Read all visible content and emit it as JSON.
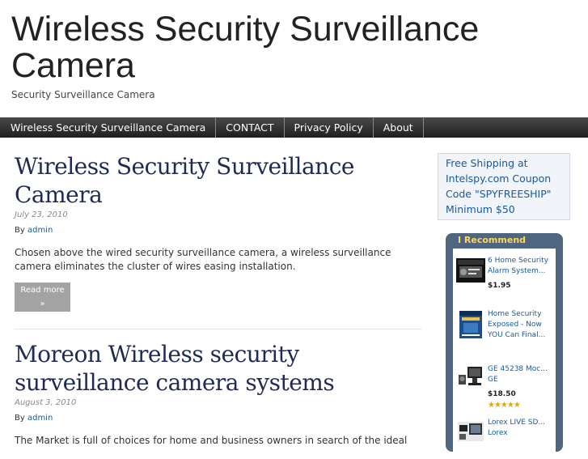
{
  "site": {
    "title": "Wireless Security Surveillance Camera",
    "description": "Security Surveillance Camera"
  },
  "nav": [
    "Wireless Security Surveillance Camera",
    "CONTACT",
    "Privacy Policy",
    "About"
  ],
  "posts": [
    {
      "title": "Wireless Security Surveillance Camera",
      "date": "July 23, 2010",
      "by_label": "By",
      "author": "admin",
      "excerpt": "Chosen above the wired security surveillance camera, a wireless surveillance camera eliminates the cluster of wires easing installation.",
      "read_more": "Read more",
      "read_more_arrow": "»"
    },
    {
      "title": "Moreon Wireless security surveillance camera systems",
      "date": "August 3, 2010",
      "by_label": "By",
      "author": "admin",
      "excerpt": "The Market is full of choices for home and business owners in search of the ideal"
    }
  ],
  "promo": {
    "text": "Free Shipping at Intelspy.com Coupon Code \"SPYFREESHIP\" Minimum $50"
  },
  "recommend": {
    "title": "I Recommend",
    "items": [
      {
        "name": "6 Home Security Alarm System...",
        "price": "$1.95",
        "thumb_icon": "dvd-case-icon"
      },
      {
        "name": "Home Security Exposed - Now YOU Can Final...",
        "price": "",
        "thumb_icon": "book-cover-icon"
      },
      {
        "name": "GE 45238 Moc... GE",
        "price": "$18.50",
        "rating": "★★★★★",
        "thumb_icon": "camera-monitor-icon"
      },
      {
        "name": "Lorex LIVE SD... Lorex",
        "price": "",
        "thumb_icon": "surveillance-kit-icon"
      }
    ]
  }
}
